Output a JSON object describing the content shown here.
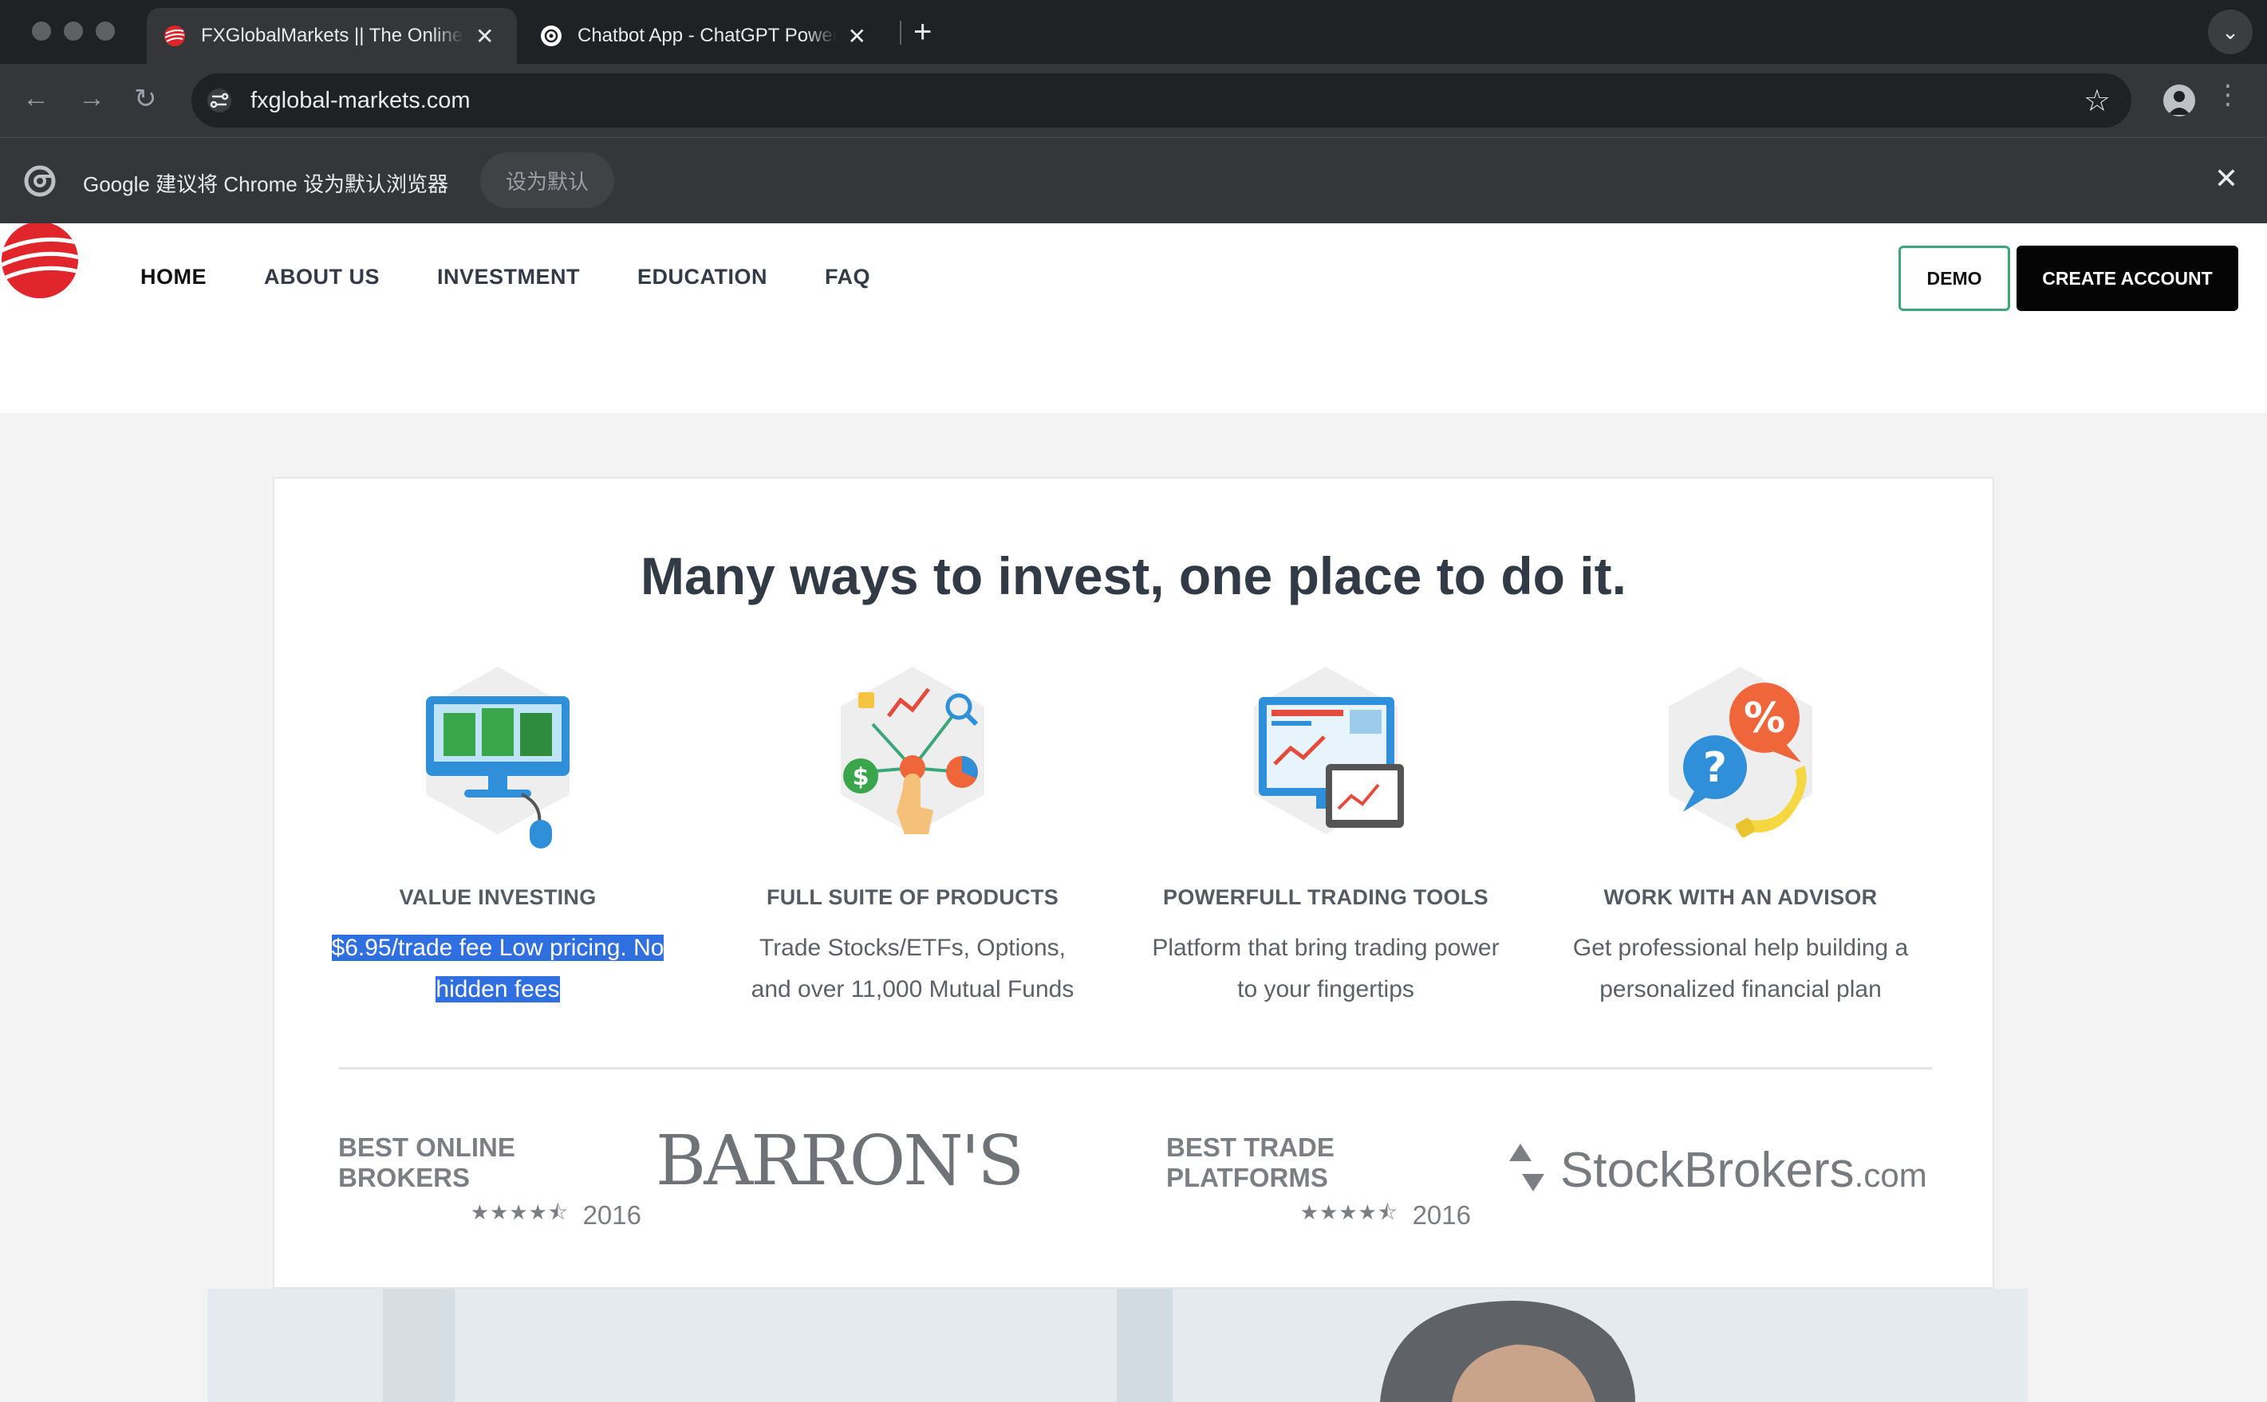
{
  "browser": {
    "tabs": [
      {
        "title": "FXGlobalMarkets || The Online Trading",
        "active": true
      },
      {
        "title": "Chatbot App - ChatGPT Powered",
        "active": false
      }
    ],
    "url": "fxglobal-markets.com",
    "infobar": {
      "message": "Google 建议将 Chrome 设为默认浏览器",
      "button": "设为默认"
    }
  },
  "site": {
    "nav": [
      {
        "label": "HOME",
        "active": true
      },
      {
        "label": "ABOUT US"
      },
      {
        "label": "INVESTMENT"
      },
      {
        "label": "EDUCATION"
      },
      {
        "label": "FAQ"
      }
    ],
    "demo_button": "DEMO",
    "create_account_button": "CREATE ACCOUNT",
    "headline": "Many ways to invest, one place to do it.",
    "features": [
      {
        "icon": "monitor-money-icon",
        "title": "VALUE INVESTING",
        "desc": "$6.95/trade fee Low pricing. No hidden fees"
      },
      {
        "icon": "products-hub-icon",
        "title": "FULL SUITE OF PRODUCTS",
        "desc": "Trade Stocks/ETFs, Options, and over 11,000 Mutual Funds"
      },
      {
        "icon": "trading-screens-icon",
        "title": "POWERFULL TRADING TOOLS",
        "desc": "Platform that bring trading power to your fingertips"
      },
      {
        "icon": "advisor-chat-icon",
        "title": "WORK WITH AN ADVISOR",
        "desc": "Get professional help building a personalized financial plan"
      }
    ],
    "awards": [
      {
        "title": "BEST ONLINE BROKERS",
        "rating": 4.5,
        "year": "2016",
        "brand": "BARRON'S"
      },
      {
        "title": "BEST TRADE PLATFORMS",
        "rating": 4.5,
        "year": "2016",
        "brand_main": "StockBrokers",
        "brand_suffix": ".com"
      }
    ],
    "colors": {
      "accent_green": "#3aa679",
      "brand_red": "#e0262b",
      "selection": "#2f6fe0"
    }
  }
}
